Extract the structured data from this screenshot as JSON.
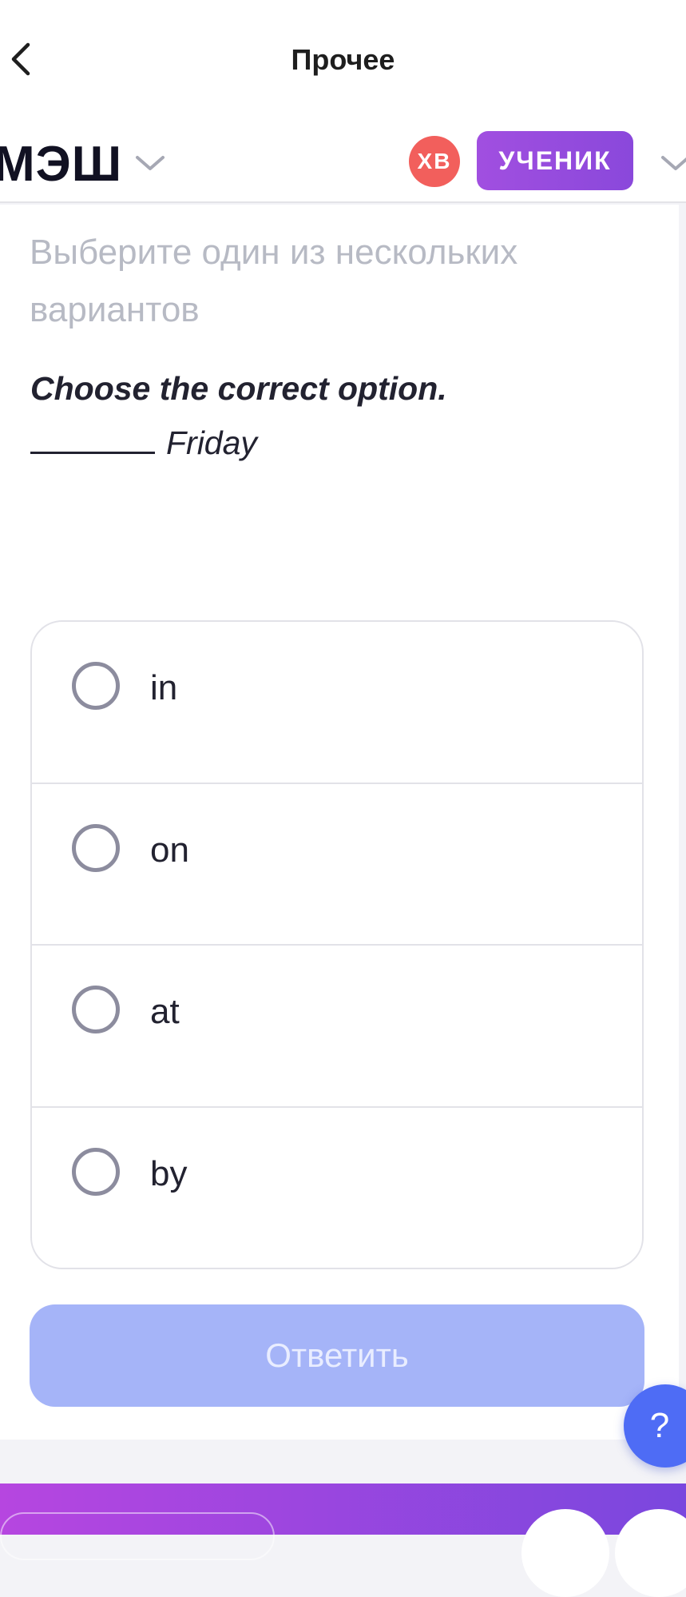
{
  "screen": {
    "title": "Прочее"
  },
  "header": {
    "logo": "МЭШ",
    "avatar_initials": "ХВ",
    "role_badge": "УЧЕНИК"
  },
  "task": {
    "hint": "Выберите один из нескольких вариантов",
    "question": "Choose the correct option.",
    "sentence_tail": "Friday",
    "options": [
      {
        "label": "in"
      },
      {
        "label": "on"
      },
      {
        "label": "at"
      },
      {
        "label": "by"
      }
    ],
    "submit_label": "Ответить"
  },
  "help": {
    "label": "?"
  },
  "colors": {
    "accent": "#4E6CF5",
    "submit_disabled": "#A5B4F8",
    "role_badge": "#8A48DB",
    "avatar": "#F25F5C"
  }
}
